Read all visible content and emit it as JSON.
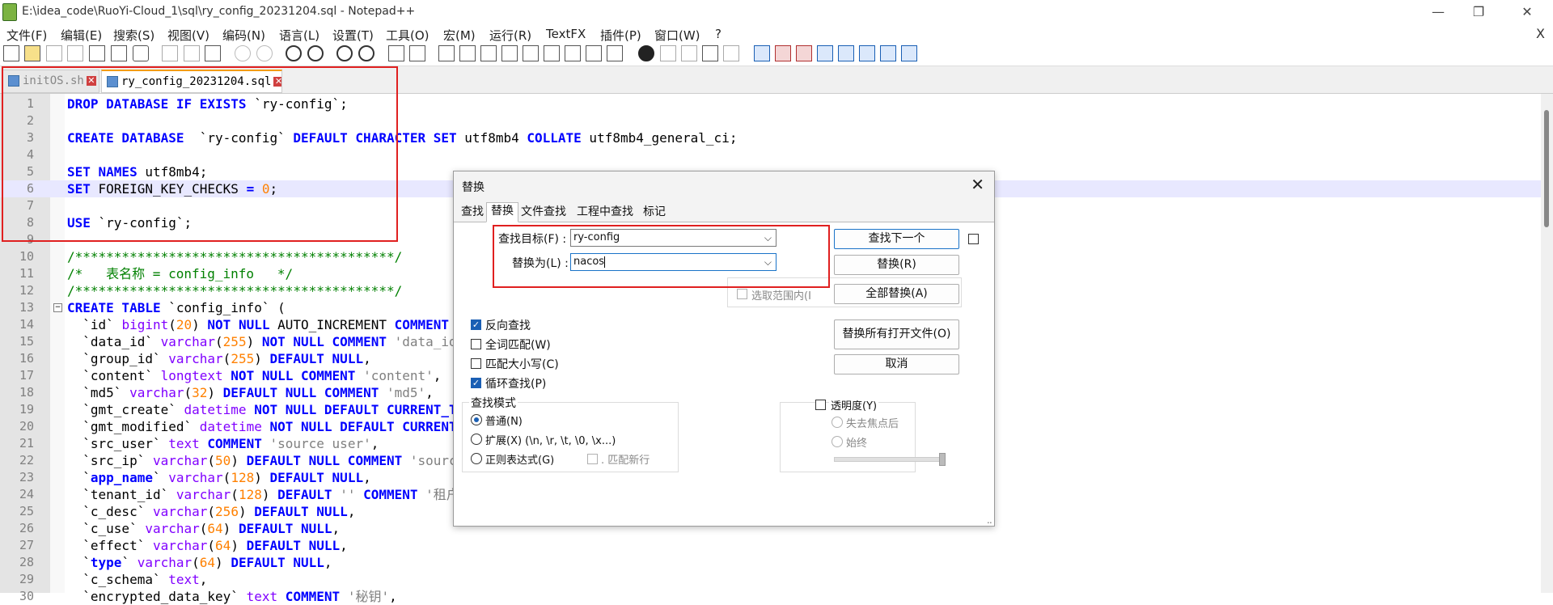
{
  "window": {
    "title": "E:\\idea_code\\RuoYi-Cloud_1\\sql\\ry_config_20231204.sql - Notepad++",
    "minimize": "—",
    "maximize": "❐",
    "close": "✕"
  },
  "menu": {
    "items": [
      "文件(F)",
      "编辑(E)",
      "搜索(S)",
      "视图(V)",
      "编码(N)",
      "语言(L)",
      "设置(T)",
      "工具(O)",
      "宏(M)",
      "运行(R)",
      "TextFX",
      "插件(P)",
      "窗口(W)",
      "?"
    ],
    "close_doc": "X"
  },
  "tabs": [
    {
      "label": "initOS.sh",
      "active": false
    },
    {
      "label": "ry_config_20231204.sql",
      "active": true
    }
  ],
  "editor": {
    "line_numbers": [
      "1",
      "2",
      "3",
      "4",
      "5",
      "6",
      "7",
      "8",
      "9",
      "10",
      "11",
      "12",
      "13",
      "14",
      "15",
      "16",
      "17",
      "18",
      "19",
      "20",
      "21",
      "22",
      "23",
      "24",
      "25",
      "26",
      "27",
      "28",
      "29",
      "30"
    ],
    "highlighted_line": 6,
    "fold_marker_line": 13
  },
  "dialog": {
    "title": "替换",
    "close": "✕",
    "tabs": [
      "查找",
      "替换",
      "文件查找",
      "工程中查找",
      "标记"
    ],
    "active_tab": "替换",
    "find_label": "查找目标(F) :",
    "find_value": "ry-config",
    "replace_label": "替换为(L) :",
    "replace_value": "nacos",
    "in_selection_label": "选取范围内(I",
    "buttons": {
      "find_next": "查找下一个",
      "replace": "替换(R)",
      "replace_all": "全部替换(A)",
      "replace_all_open": "替换所有打开文件(O)",
      "cancel": "取消"
    },
    "options": [
      {
        "label": "反向查找",
        "checked": true
      },
      {
        "label": "全词匹配(W)",
        "checked": false
      },
      {
        "label": "匹配大小写(C)",
        "checked": false
      },
      {
        "label": "循环查找(P)",
        "checked": true
      }
    ],
    "search_mode": {
      "title": "查找模式",
      "normal": "普通(N)",
      "extended": "扩展(X) (\\n, \\r, \\t, \\0, \\x...)",
      "regex": "正则表达式(G)",
      "match_newline": ". 匹配新行",
      "selected": "普通(N)"
    },
    "transparency": {
      "title": "透明度(Y)",
      "on_lose_focus": "失去焦点后",
      "always": "始终"
    },
    "dropdown_arrow": "⌵",
    "resize_grip": "⣀"
  }
}
